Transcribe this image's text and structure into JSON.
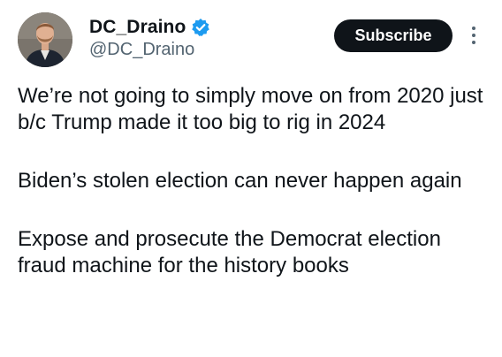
{
  "author": {
    "display_name": "DC_Draino",
    "handle": "@DC_Draino",
    "verified_icon": "verified-badge-icon"
  },
  "actions": {
    "subscribe_label": "Subscribe",
    "more_icon": "more-options-icon"
  },
  "tweet": {
    "paragraphs": [
      "We’re not going to simply move on from 2020 just b/c Trump made it too big to rig in 2024",
      "Biden’s stolen election can never happen again",
      "Expose and prosecute the Democrat election fraud machine for the history books"
    ]
  },
  "colors": {
    "text": "#0f1419",
    "secondary_text": "#536471",
    "verified": "#1d9bf0",
    "button_bg": "#0f1419",
    "button_text": "#ffffff"
  }
}
